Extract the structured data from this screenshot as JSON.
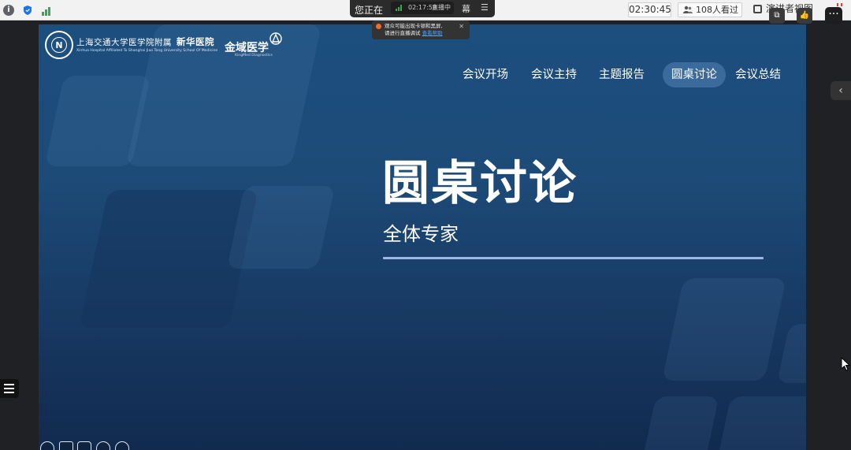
{
  "topbar": {
    "sharing_text": "您正在",
    "stream_time": "02:17:58",
    "stream_status": "直播中",
    "btn_screen": "幕",
    "timer": "02:30:45",
    "viewers": "108人看过",
    "presenter_view": "演讲者视图"
  },
  "notice": {
    "line1": "观众可能出现卡顿和黑屏,",
    "line2_prefix": "请进行直播调试",
    "link": "查看帮助"
  },
  "slide": {
    "hospital_cn": "上海交通大学医学院附属",
    "hospital_name": "新华医院",
    "hospital_en": "Xinhua Hospital Affiliated To Shanghai Jiao Tong University School Of Medicine",
    "seal_letter": "N",
    "kingmed_cn": "金域医学",
    "kingmed_en": "KingMed Diagnostics",
    "nav": [
      {
        "label": "会议开场"
      },
      {
        "label": "会议主持"
      },
      {
        "label": "主题报告"
      },
      {
        "label": "圆桌讨论",
        "active": true
      },
      {
        "label": "会议总结"
      }
    ],
    "title": "圆桌讨论",
    "subtitle": "全体专家"
  },
  "colors": {
    "slide_top": "#1c4e7e",
    "slide_bottom": "#112a4e",
    "divider": "#9cb7e8",
    "nav_active_bg": "#4d7fb6",
    "live_green": "#34a853"
  }
}
